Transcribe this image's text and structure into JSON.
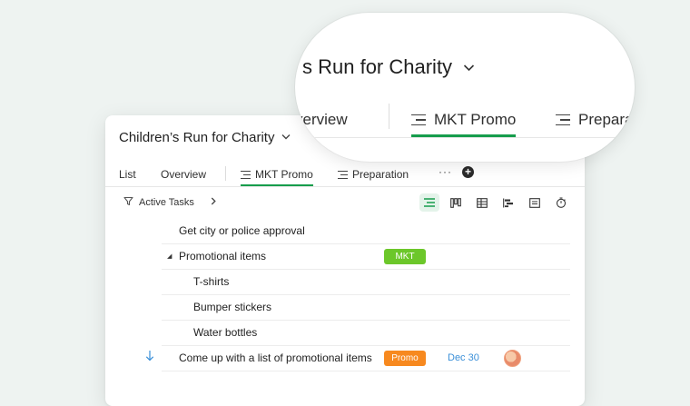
{
  "project": {
    "title": "Children’s Run for Charity"
  },
  "tabs": [
    {
      "label": "List"
    },
    {
      "label": "Overview"
    },
    {
      "label": "MKT Promo",
      "active": true
    },
    {
      "label": "Preparation"
    }
  ],
  "more_label": "···",
  "filter": {
    "label": "Active Tasks"
  },
  "tasks": [
    {
      "name": "Get city or police approval"
    },
    {
      "name": "Promotional items",
      "tag": "MKT",
      "tag_color": "#6cc72a",
      "expanded": true
    },
    {
      "name": "T-shirts"
    },
    {
      "name": "Bumper stickers"
    },
    {
      "name": "Water bottles"
    },
    {
      "name": "Come up with a list of promotional items",
      "tag": "Promo",
      "tag_color": "#f7891f",
      "date": "Dec 30"
    }
  ],
  "magnifier": {
    "title": "s Run for Charity",
    "tab_partial_left": "verview",
    "tab_active": "MKT Promo",
    "tab_partial_right": "Prepara"
  },
  "colors": {
    "accent": "#169d4c",
    "date": "#3a8fd8"
  }
}
